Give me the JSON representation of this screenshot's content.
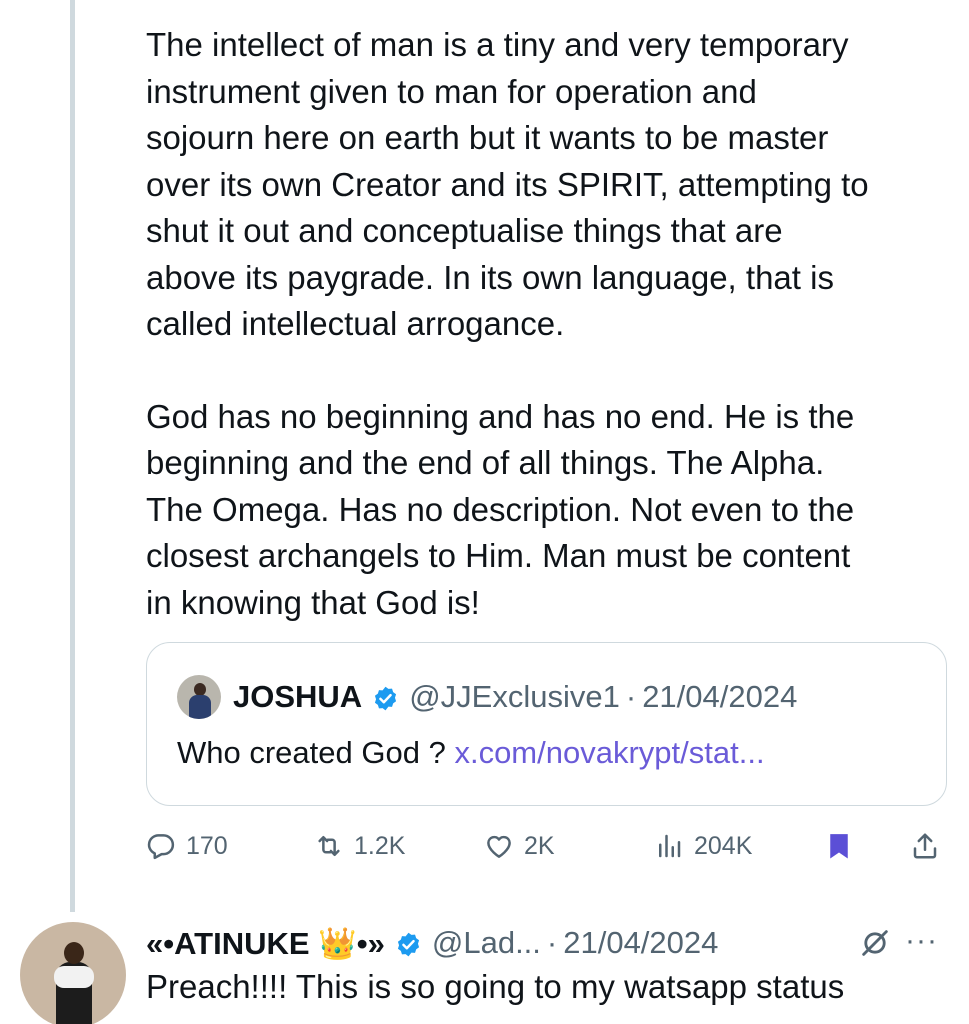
{
  "tweet": {
    "paragraphs": [
      "The intellect of man is a tiny and very temporary\ninstrument given to man for operation and\nsojourn here on earth but it wants to be master\nover its own Creator and its SPIRIT, attempting to\nshut it out and conceptualise things that are\nabove its paygrade. In its own language, that is\ncalled intellectual arrogance.",
      "God has no beginning and has no end. He is the\nbeginning and the end of all things. The Alpha.\nThe Omega. Has no description. Not even to the\nclosest archangels to Him. Man must be content\nin knowing that God is!"
    ]
  },
  "quote": {
    "name": "JOSHUA",
    "handle": "@JJExclusive1",
    "separator": "·",
    "date": "21/04/2024",
    "text": "Who created God ?",
    "link": "x.com/novakrypt/stat..."
  },
  "actions": {
    "replies": "170",
    "reposts": "1.2K",
    "likes": "2K",
    "views": "204K"
  },
  "reply": {
    "name": "«•ATINUKE 👑•»",
    "handle": "@Lad...",
    "separator": "·",
    "date": "21/04/2024",
    "more": "···",
    "text": "Preach!!!! This is so going to my watsapp status"
  },
  "colors": {
    "accent": "#1d9bf0",
    "link": "#6a5bd8",
    "bookmark": "#5b4fd6",
    "muted": "#536471",
    "border": "#cfd9de"
  }
}
